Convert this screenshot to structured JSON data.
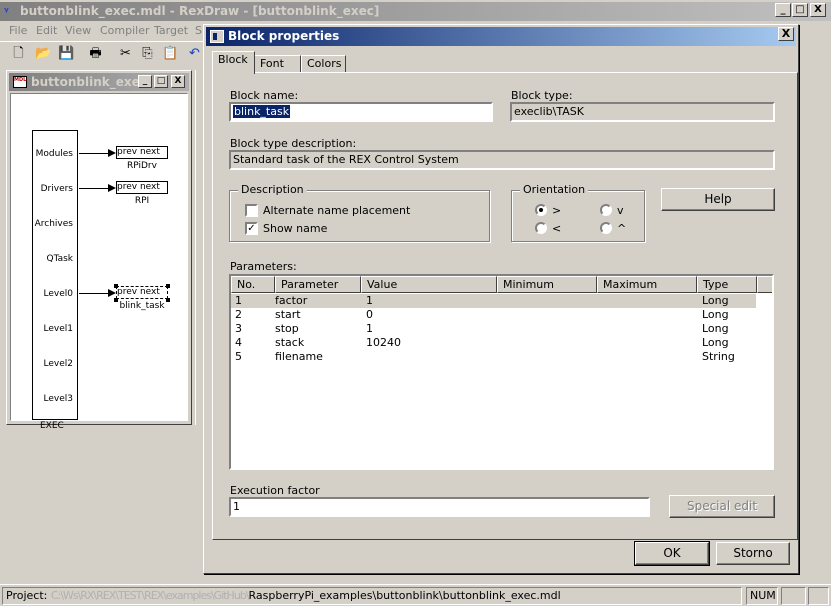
{
  "app": {
    "title": "buttonblink_exec.mdl - RexDraw - [buttonblink_exec]",
    "window_buttons": [
      "_",
      "□",
      "X"
    ]
  },
  "menu": [
    "File",
    "Edit",
    "View",
    "Compiler",
    "Target",
    "S"
  ],
  "toolbar": [
    "new-icon",
    "open-icon",
    "save-icon",
    "print-icon",
    "cut-icon",
    "copy-icon",
    "paste-icon",
    "undo-icon"
  ],
  "mdi": {
    "title": "buttonblink_exec",
    "icon_text": "MDL",
    "exec_block": {
      "name": "EXEC",
      "outputs": [
        "Modules",
        "Drivers",
        "Archives",
        "QTask",
        "Level0",
        "Level1",
        "Level2",
        "Level3"
      ]
    },
    "tasks": [
      {
        "ports": "prev  next",
        "name": "RPiDrv"
      },
      {
        "ports": "prev  next",
        "name": "RPI"
      },
      {
        "ports": "prev  next",
        "name": "blink_task"
      }
    ]
  },
  "status": {
    "project_label": "Project:",
    "project_path_hidden": "C:\\Ws\\RX\\REX\\TEST\\REX\\examples\\GitHub\\",
    "project_path_visible": "RaspberryPi_examples\\buttonblink\\buttonblink_exec.mdl",
    "num": "NUM"
  },
  "dialog": {
    "title": "Block properties",
    "close": "X",
    "tabs": [
      "Block",
      "Font",
      "Colors"
    ],
    "block_name_label": "Block name:",
    "block_name": "blink_task",
    "block_type_label": "Block type:",
    "block_type": "execlib\\TASK",
    "desc_label": "Block type description:",
    "desc": "Standard task of the REX Control System",
    "description_group": "Description",
    "alt_name": "Alternate name placement",
    "show_name": "Show name",
    "orientation_group": "Orientation",
    "orientation": [
      ">",
      "<",
      "v",
      "^"
    ],
    "help": "Help",
    "params_label": "Parameters:",
    "columns": [
      "No.",
      "Parameter",
      "Value",
      "Minimum",
      "Maximum",
      "Type"
    ],
    "rows": [
      {
        "no": "1",
        "param": "factor",
        "value": "1",
        "min": "",
        "max": "",
        "type": "Long"
      },
      {
        "no": "2",
        "param": "start",
        "value": "0",
        "min": "",
        "max": "",
        "type": "Long"
      },
      {
        "no": "3",
        "param": "stop",
        "value": "1",
        "min": "",
        "max": "",
        "type": "Long"
      },
      {
        "no": "4",
        "param": "stack",
        "value": "10240",
        "min": "",
        "max": "",
        "type": "Long"
      },
      {
        "no": "5",
        "param": "filename",
        "value": "",
        "min": "",
        "max": "",
        "type": "String"
      }
    ],
    "exec_factor_label": "Execution factor",
    "exec_factor": "1",
    "special_edit": "Special edit",
    "ok": "OK",
    "cancel": "Storno"
  }
}
